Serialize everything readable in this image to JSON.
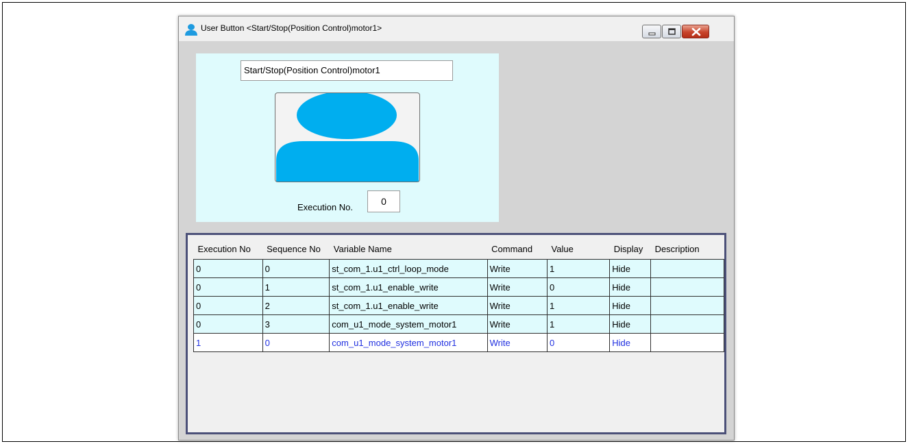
{
  "window": {
    "title": "User Button <Start/Stop(Position Control)motor1>"
  },
  "button_editor": {
    "caption": "Start/Stop(Position Control)motor1",
    "execution_label": "Execution No.",
    "execution_value": "0",
    "button_image_icon": "user-silhouette-icon"
  },
  "table": {
    "columns": [
      "Execution No",
      "Sequence No",
      "Variable Name",
      "Command",
      "Value",
      "Display",
      "Description"
    ],
    "rows": [
      {
        "execution_no": "0",
        "sequence_no": "0",
        "variable": "st_com_1.u1_ctrl_loop_mode",
        "command": "Write",
        "value": "1",
        "display": "Hide",
        "description": ""
      },
      {
        "execution_no": "0",
        "sequence_no": "1",
        "variable": "st_com_1.u1_enable_write",
        "command": "Write",
        "value": "0",
        "display": "Hide",
        "description": ""
      },
      {
        "execution_no": "0",
        "sequence_no": "2",
        "variable": "st_com_1.u1_enable_write",
        "command": "Write",
        "value": "1",
        "display": "Hide",
        "description": ""
      },
      {
        "execution_no": "0",
        "sequence_no": "3",
        "variable": "com_u1_mode_system_motor1",
        "command": "Write",
        "value": "1",
        "display": "Hide",
        "description": ""
      },
      {
        "execution_no": "1",
        "sequence_no": "0",
        "variable": "com_u1_mode_system_motor1",
        "command": "Write",
        "value": "0",
        "display": "Hide",
        "description": ""
      }
    ]
  },
  "colors": {
    "panel_background": "#dffbfd",
    "icon_blue": "#00aeef",
    "selected_row_text": "#1f2fe0",
    "grid_border": "#4b5078"
  }
}
